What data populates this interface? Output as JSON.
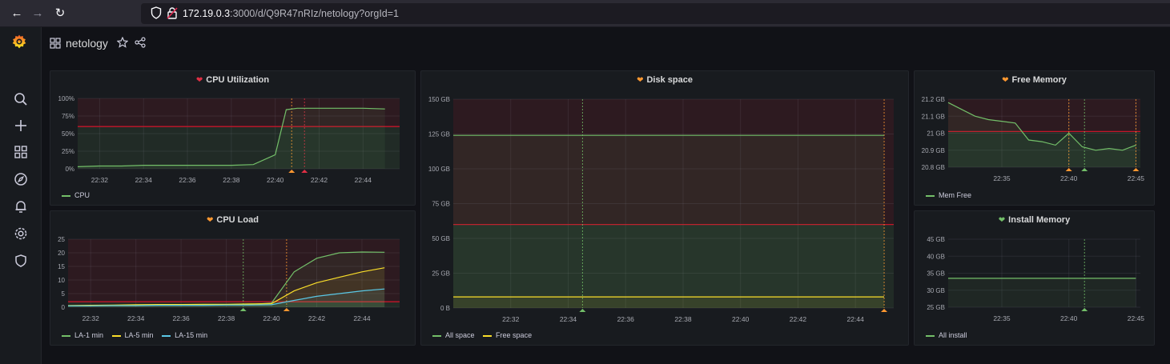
{
  "browser": {
    "url_host": "172.19.0.3",
    "url_rest": ":3000/d/Q9R47nRIz/netology?orgId=1"
  },
  "dashboard": {
    "title": "netology"
  },
  "colors": {
    "green": "#73bf69",
    "yellow": "#fade2a",
    "orange": "#ff9830",
    "blue": "#8ab8ff",
    "cyan": "#5ac8e6",
    "red": "#e02f44",
    "threshold": "#c4162a"
  },
  "sidebar": {
    "icons": [
      "grafana-logo-icon",
      "search-icon",
      "plus-icon",
      "dashboards-icon",
      "explore-icon",
      "alerting-icon",
      "config-icon",
      "shield-icon"
    ]
  },
  "panels": {
    "cpu_util": {
      "title": "CPU Utilization",
      "status_color": "#e02f44",
      "legend": [
        {
          "name": "CPU",
          "color": "#73bf69"
        }
      ],
      "y_ticks": [
        "100%",
        "75%",
        "50%",
        "25%",
        "0%"
      ],
      "x_ticks": [
        "22:32",
        "22:34",
        "22:36",
        "22:38",
        "22:40",
        "22:42",
        "22:44"
      ]
    },
    "cpu_load": {
      "title": "CPU Load",
      "status_color": "#ff9830",
      "legend": [
        {
          "name": "LA-1 min",
          "color": "#73bf69"
        },
        {
          "name": "LA-5 min",
          "color": "#fade2a"
        },
        {
          "name": "LA-15 min",
          "color": "#5ac8e6"
        }
      ],
      "y_ticks": [
        "25",
        "20",
        "15",
        "10",
        "5",
        "0"
      ],
      "x_ticks": [
        "22:32",
        "22:34",
        "22:36",
        "22:38",
        "22:40",
        "22:42",
        "22:44"
      ]
    },
    "disk": {
      "title": "Disk space",
      "status_color": "#ff9830",
      "legend": [
        {
          "name": "All space",
          "color": "#73bf69"
        },
        {
          "name": "Free space",
          "color": "#fade2a"
        }
      ],
      "y_ticks": [
        "150 GB",
        "125 GB",
        "100 GB",
        "75 GB",
        "50 GB",
        "25 GB",
        "0 B"
      ],
      "x_ticks": [
        "22:32",
        "22:34",
        "22:36",
        "22:38",
        "22:40",
        "22:42",
        "22:44"
      ]
    },
    "free_mem": {
      "title": "Free Memory",
      "status_color": "#ff9830",
      "legend": [
        {
          "name": "Mem Free",
          "color": "#73bf69"
        }
      ],
      "y_ticks": [
        "21.2 GB",
        "21.1 GB",
        "21 GB",
        "20.9 GB",
        "20.8 GB"
      ],
      "x_ticks": [
        "22:35",
        "22:40",
        "22:45"
      ]
    },
    "install_mem": {
      "title": "Install Memory",
      "status_color": "#73bf69",
      "legend": [
        {
          "name": "All install",
          "color": "#73bf69"
        }
      ],
      "y_ticks": [
        "45 GB",
        "40 GB",
        "35 GB",
        "30 GB",
        "25 GB"
      ],
      "x_ticks": [
        "22:35",
        "22:40",
        "22:45"
      ]
    }
  },
  "chart_data": [
    {
      "type": "line",
      "title": "CPU Utilization",
      "x": [
        "22:31",
        "22:32",
        "22:33",
        "22:34",
        "22:35",
        "22:36",
        "22:37",
        "22:38",
        "22:39",
        "22:40",
        "22:40:30",
        "22:41",
        "22:42",
        "22:43",
        "22:44",
        "22:45"
      ],
      "series": [
        {
          "name": "CPU",
          "values": [
            3,
            4,
            4,
            5,
            5,
            5,
            5,
            5,
            6,
            20,
            84,
            86,
            86,
            86,
            86,
            85
          ]
        }
      ],
      "threshold": 60,
      "ylim": [
        0,
        100
      ]
    },
    {
      "type": "line",
      "title": "CPU Load",
      "x": [
        "22:31",
        "22:32",
        "22:33",
        "22:34",
        "22:35",
        "22:36",
        "22:37",
        "22:38",
        "22:39",
        "22:40",
        "22:41",
        "22:42",
        "22:43",
        "22:44",
        "22:45"
      ],
      "series": [
        {
          "name": "LA-1 min",
          "values": [
            0.5,
            0.6,
            0.7,
            0.7,
            0.8,
            0.8,
            0.9,
            0.9,
            1,
            1.5,
            13,
            18,
            20,
            20.3,
            20.2
          ]
        },
        {
          "name": "LA-5 min",
          "values": [
            0.6,
            0.7,
            0.8,
            0.9,
            1,
            1,
            1.1,
            1.1,
            1.2,
            1.3,
            6,
            9,
            11,
            13,
            14.5
          ]
        },
        {
          "name": "LA-15 min",
          "values": [
            0.5,
            0.5,
            0.6,
            0.6,
            0.7,
            0.7,
            0.7,
            0.8,
            0.8,
            0.9,
            2.5,
            4,
            5,
            6,
            6.7
          ]
        }
      ],
      "threshold": 2,
      "ylim": [
        0,
        25
      ]
    },
    {
      "type": "area",
      "title": "Disk space",
      "x": [
        "22:30",
        "22:45"
      ],
      "series": [
        {
          "name": "All space",
          "values": [
            124,
            124
          ]
        },
        {
          "name": "Free space",
          "values": [
            8,
            8
          ]
        }
      ],
      "threshold": 60,
      "ylim": [
        0,
        150
      ]
    },
    {
      "type": "line",
      "title": "Free Memory",
      "x": [
        "22:31",
        "22:32",
        "22:33",
        "22:34",
        "22:35",
        "22:36",
        "22:37",
        "22:38",
        "22:39",
        "22:40",
        "22:41",
        "22:42",
        "22:43",
        "22:44",
        "22:45"
      ],
      "series": [
        {
          "name": "Mem Free",
          "values": [
            21.18,
            21.14,
            21.1,
            21.08,
            21.07,
            21.06,
            20.96,
            20.95,
            20.93,
            21.0,
            20.92,
            20.9,
            20.91,
            20.9,
            20.93
          ]
        }
      ],
      "threshold": 21.01,
      "ylim": [
        20.8,
        21.2
      ]
    },
    {
      "type": "line",
      "title": "Install Memory",
      "x": [
        "22:31",
        "22:45"
      ],
      "series": [
        {
          "name": "All install",
          "values": [
            33.5,
            33.5
          ]
        }
      ],
      "ylim": [
        25,
        45
      ]
    }
  ]
}
